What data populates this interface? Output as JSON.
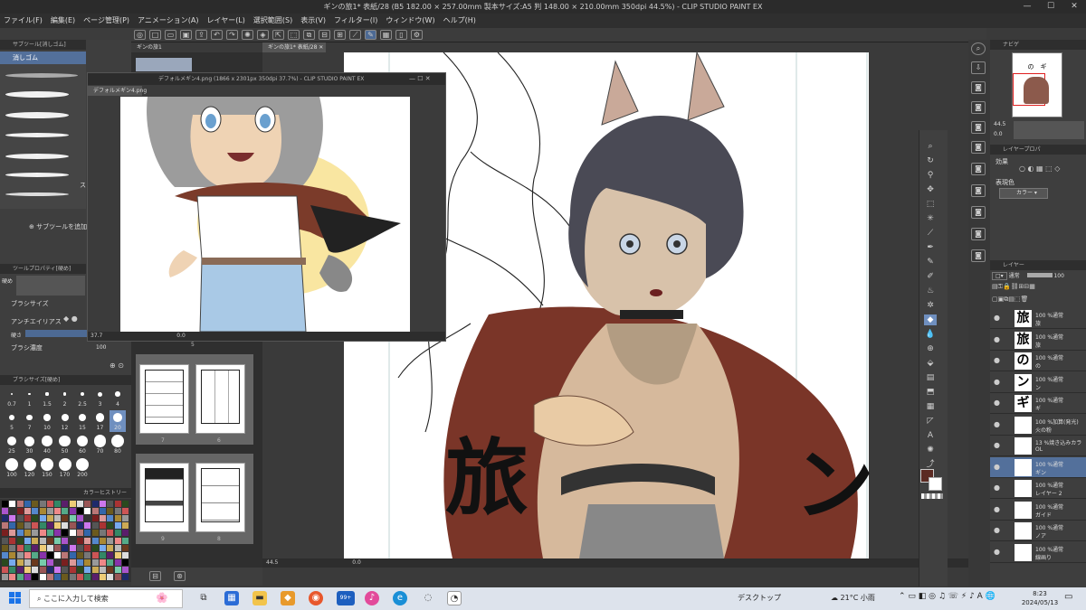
{
  "window": {
    "title": "ギンの旅1* 表紙/28 (B5 182.00 × 257.00mm 製本サイズ:A5 判 148.00 × 210.00mm 350dpi 44.5%) - CLIP STUDIO PAINT EX",
    "minimize": "—",
    "maximize": "☐",
    "close": "✕"
  },
  "menu": [
    "ファイル(F)",
    "編集(E)",
    "ページ管理(P)",
    "アニメーション(A)",
    "レイヤー(L)",
    "選択範囲(S)",
    "表示(V)",
    "フィルター(I)",
    "ウィンドウ(W)",
    "ヘルプ(H)"
  ],
  "subtool": {
    "header": "サブツール[消しゴム]",
    "active": "消しゴム",
    "add_label": "サブツールを追加",
    "header_right": "ス"
  },
  "toolprop": {
    "header": "ツールプロパティ[硬め]",
    "preset": "硬め",
    "brush_size": "ブラシサイズ",
    "antialias": "アンチエイリアス",
    "hardness": "硬さ",
    "density": "ブラシ濃度",
    "density_value": "100"
  },
  "brushsize": {
    "header": "ブラシサイズ[硬め]",
    "sizes": [
      "0.7",
      "1",
      "1.5",
      "2",
      "2.5",
      "3",
      "4",
      "5",
      "7",
      "10",
      "12",
      "15",
      "17",
      "20",
      "25",
      "30",
      "40",
      "50",
      "60",
      "70",
      "80",
      "100",
      "120",
      "150",
      "170",
      "200"
    ]
  },
  "colorhist": {
    "header": "カラーヒストリー"
  },
  "docs": {
    "tab1": "ギンの旅1",
    "tab2": "ギンの旅1* 表紙/28"
  },
  "ref": {
    "tab": "デフォルメギン4.png",
    "title": "デフォルメギン4.png (1866 x 2301px 350dpi 37.7%) - CLIP STUDIO PAINT EX",
    "zoom": "37.7",
    "angle": "0.0"
  },
  "pages": {
    "labels": [
      "7",
      "6",
      "9",
      "8"
    ],
    "top": "5"
  },
  "canvas": {
    "zoom": "44.5",
    "angle": "0.0",
    "char_left": "旅",
    "char_right": "ン"
  },
  "navigator": {
    "header": "ナビゲ",
    "zoom": "44.5",
    "angle": "0.0",
    "title_text": "の　ギ"
  },
  "layerprop": {
    "header": "レイヤープロパ",
    "effect": "効果",
    "display_color": "表現色",
    "color_value": "カラー"
  },
  "layers": {
    "header": "レイヤー",
    "blend": "通常",
    "opacity": "100",
    "rows": [
      {
        "thumb": "旅",
        "line1": "100 %通常",
        "line2": "旅"
      },
      {
        "thumb": "旅",
        "line1": "100 %通常",
        "line2": "旅"
      },
      {
        "thumb": "の",
        "line1": "100 %通常",
        "line2": "の"
      },
      {
        "thumb": "ン",
        "line1": "100 %通常",
        "line2": "ン"
      },
      {
        "thumb": "ギ",
        "line1": "100 %通常",
        "line2": "ギ"
      },
      {
        "thumb": "",
        "line1": "100 %加算(発光)",
        "line2": "火の粉"
      },
      {
        "thumb": "",
        "line1": "13 %焼き込みカラ",
        "line2": "OL"
      },
      {
        "thumb": "",
        "line1": "100 %通常",
        "line2": "ギン"
      },
      {
        "thumb": "",
        "line1": "100 %通常",
        "line2": "レイヤー 2"
      },
      {
        "thumb": "",
        "line1": "100 %通常",
        "line2": "ガイド"
      },
      {
        "thumb": "",
        "line1": "100 %通常",
        "line2": "ノア"
      },
      {
        "thumb": "",
        "line1": "100 %通常",
        "line2": "線画り"
      }
    ]
  },
  "taskbar": {
    "search_placeholder": "ここに入力して検索",
    "desktop": "デスクトップ",
    "weather": "21°C 小雨",
    "time": "8:23",
    "date": "2024/05/13",
    "badge": "99+"
  },
  "colors": {
    "accent": "#6f8fbf",
    "panel": "#404040",
    "canvas_bg": "#3a3a3a"
  }
}
